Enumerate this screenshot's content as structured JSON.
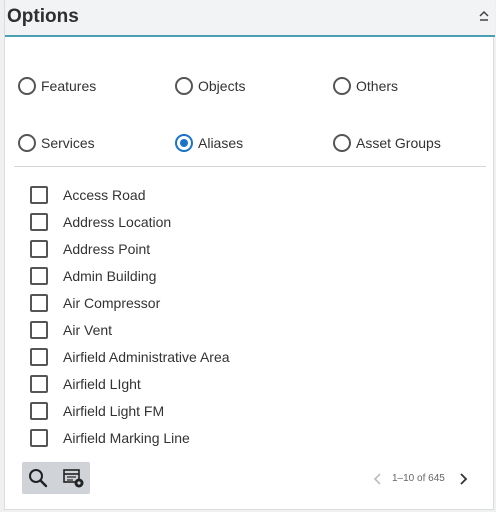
{
  "header": {
    "title": "Options"
  },
  "radio_options": [
    {
      "label": "Features",
      "checked": false
    },
    {
      "label": "Objects",
      "checked": false
    },
    {
      "label": "Others",
      "checked": false
    },
    {
      "label": "Services",
      "checked": false
    },
    {
      "label": "Aliases",
      "checked": true
    },
    {
      "label": "Asset Groups",
      "checked": false
    }
  ],
  "list_items": [
    {
      "label": "Access Road",
      "checked": false
    },
    {
      "label": "Address Location",
      "checked": false
    },
    {
      "label": "Address Point",
      "checked": false
    },
    {
      "label": "Admin Building",
      "checked": false
    },
    {
      "label": "Air Compressor",
      "checked": false
    },
    {
      "label": "Air Vent",
      "checked": false
    },
    {
      "label": "Airfield Administrative Area",
      "checked": false
    },
    {
      "label": "Airfield LIght",
      "checked": false
    },
    {
      "label": "Airfield Light FM",
      "checked": false
    },
    {
      "label": "Airfield Marking Line",
      "checked": false
    }
  ],
  "toolbar": {
    "search_icon": "search-icon",
    "settings_icon": "table-settings-icon"
  },
  "pager": {
    "text": "1–10 of 645"
  },
  "colors": {
    "accent": "#4a9fb5",
    "radio_selected": "#1a73c8"
  }
}
